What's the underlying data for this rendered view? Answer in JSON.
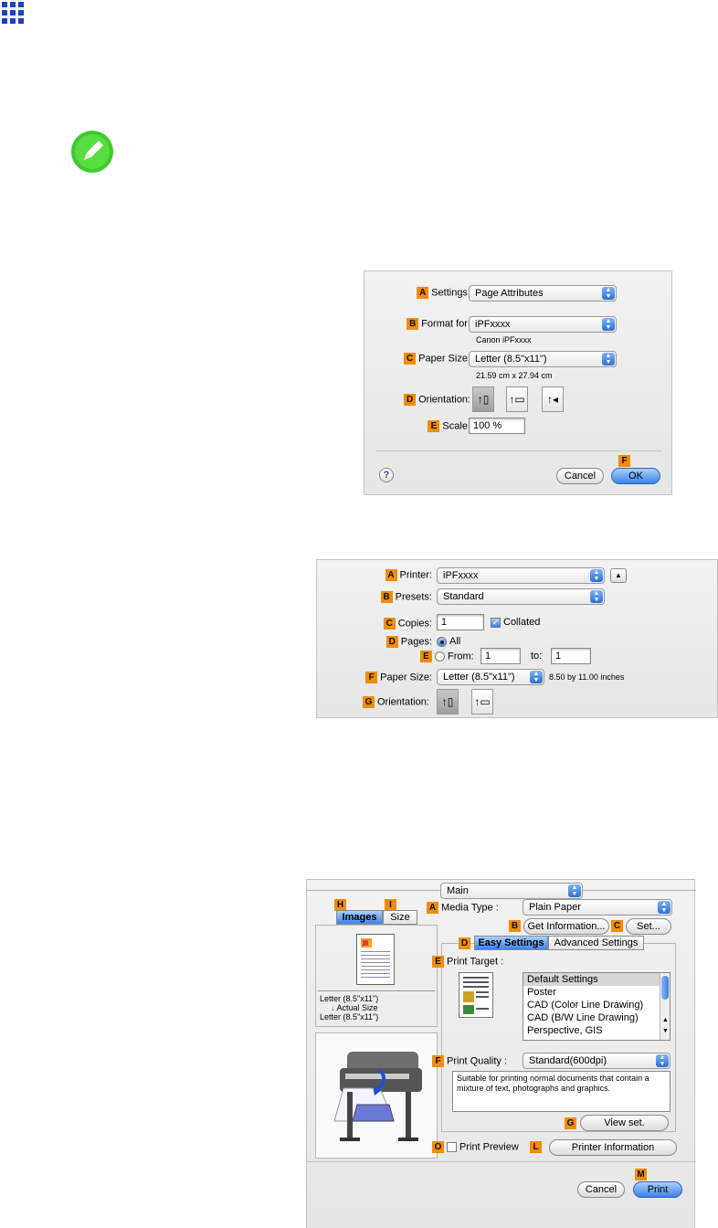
{
  "page_setup": {
    "settings_label": "Settings:",
    "settings_value": "Page Attributes",
    "format_label": "Format for:",
    "format_value": "iPFxxxx",
    "format_sub": "Canon iPFxxxx",
    "paper_label": "Paper Size:",
    "paper_value": "Letter (8.5\"x11\")",
    "paper_sub": "21.59 cm x 27.94 cm",
    "orientation_label": "Orientation:",
    "scale_label": "Scale:",
    "scale_value": "100 %",
    "cancel": "Cancel",
    "ok": "OK",
    "help": "?",
    "letters": {
      "a": "A",
      "b": "B",
      "c": "C",
      "d": "D",
      "e": "E",
      "f": "F"
    }
  },
  "print_dialog": {
    "printer_label": "Printer:",
    "printer_value": "iPFxxxx",
    "presets_label": "Presets:",
    "presets_value": "Standard",
    "copies_label": "Copies:",
    "copies_value": "1",
    "collated": "Collated",
    "pages_label": "Pages:",
    "all": "All",
    "from_label": "From:",
    "from_value": "1",
    "to_label": "to:",
    "to_value": "1",
    "paper_label": "Paper Size:",
    "paper_value": "Letter (8.5\"x11\")",
    "paper_info": "8.50 by 11.00 inches",
    "orientation_label": "Orientation:",
    "letters": {
      "a": "A",
      "b": "B",
      "c": "C",
      "d": "D",
      "e": "E",
      "f": "F",
      "g": "G"
    }
  },
  "driver": {
    "panel_value": "Main",
    "tab_images": "Images",
    "tab_size": "Size",
    "media_label": "Media Type :",
    "media_value": "Plain Paper",
    "get_info": "Get Information...",
    "set": "Set...",
    "easy": "Easy Settings",
    "advanced": "Advanced Settings",
    "target_label": "Print Target :",
    "targets": [
      "Default Settings",
      "Poster",
      "CAD (Color Line Drawing)",
      "CAD (B/W Line Drawing)",
      "Perspective, GIS"
    ],
    "selected_target": "Default Settings",
    "preview_line1": "Letter (8.5\"x11\")",
    "preview_line2": "Actual Size",
    "preview_line3": "Letter (8.5\"x11\")",
    "quality_label": "Print Quality :",
    "quality_value": "Standard(600dpi)",
    "description": "Suitable for printing normal documents that contain a mixture of text, photographs and graphics.",
    "view_set": "View set.",
    "print_preview": "Print Preview",
    "printer_info": "Printer Information",
    "cancel": "Cancel",
    "print": "Print",
    "letters": {
      "h": "H",
      "i": "I",
      "a": "A",
      "b": "B",
      "c": "C",
      "d": "D",
      "e": "E",
      "f": "F",
      "g": "G",
      "o": "O",
      "l": "L",
      "m": "M"
    }
  }
}
